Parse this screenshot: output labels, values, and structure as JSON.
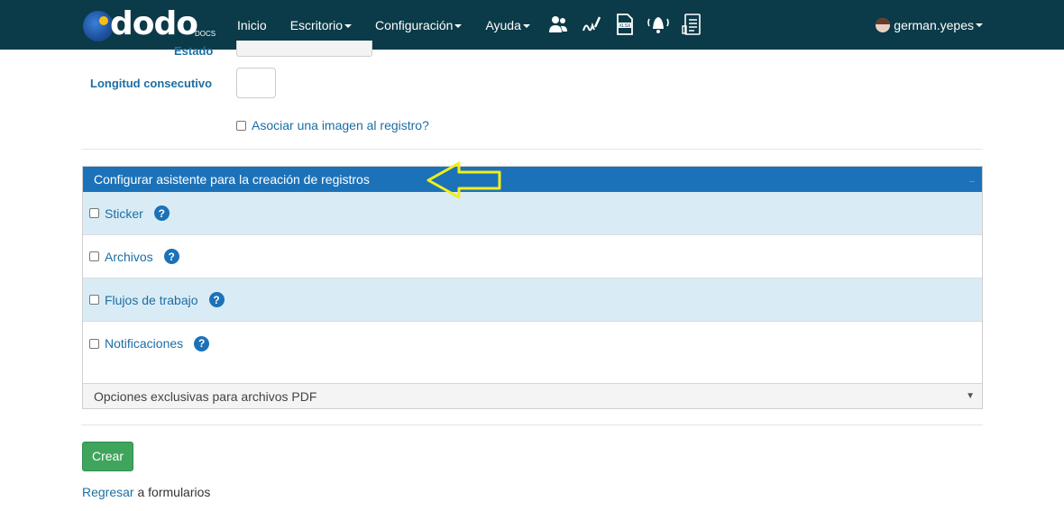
{
  "navbar": {
    "logo_text": "dodo",
    "logo_sub": "DOCS",
    "menu": [
      {
        "label": "Inicio",
        "dropdown": false
      },
      {
        "label": "Escritorio",
        "dropdown": true
      },
      {
        "label": "Configuración",
        "dropdown": true
      },
      {
        "label": "Ayuda",
        "dropdown": true
      }
    ],
    "icons": [
      "users-icon",
      "signature-icon",
      "xlsx-file-icon",
      "bell-icon",
      "document-list-icon"
    ],
    "user": "german.yepes",
    "background_color": "#0b3a48"
  },
  "form": {
    "estado_label": "Estado",
    "longitud_label": "Longitud consecutivo",
    "longitud_value": "",
    "asociar_label": "Asociar una imagen al registro?"
  },
  "panel": {
    "header": "Configurar asistente para la creación de registros",
    "header_color": "#1c72b8",
    "options": [
      {
        "label": "Sticker",
        "checked": false
      },
      {
        "label": "Archivos",
        "checked": false
      },
      {
        "label": "Flujos de trabajo",
        "checked": false
      },
      {
        "label": "Notificaciones",
        "checked": false
      }
    ],
    "pdf_select": "Opciones exclusivas para archivos PDF"
  },
  "actions": {
    "crear": "Crear",
    "regresar_link": "Regresar",
    "regresar_rest": "a formularios"
  },
  "annotation": {
    "arrow_color": "#f2ee1a"
  }
}
